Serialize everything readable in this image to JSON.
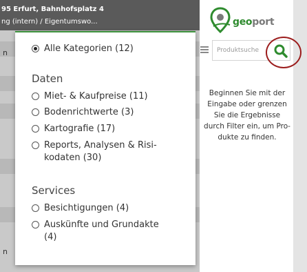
{
  "background": {
    "header_line1": "95 Erfurt, Bahnhofsplatz 4",
    "header_line2": "ng (intern) / Eigentumswo...",
    "left_text_1": "n",
    "left_text_2": "n"
  },
  "logo": {
    "text_geo": "geo",
    "text_port": "port",
    "accent_color": "#2e8b2e"
  },
  "search": {
    "placeholder": "Produktsuche",
    "button_icon": "search-icon"
  },
  "hint_text": "Beginnen Sie mit der Eingabe oder grenzen Sie die Er­gebnisse durch Fil­ter ein, um Pro­dukte zu finden.",
  "filter": {
    "all": {
      "label": "Alle Kategorien (12)",
      "selected": true
    },
    "sections": [
      {
        "title": "Daten",
        "items": [
          {
            "label": "Miet- & Kaufpreise (11)"
          },
          {
            "label": "Bodenrichtwerte (3)"
          },
          {
            "label": "Kartografie (17)"
          },
          {
            "label": "Reports, Analysen & Risi-kodaten (30)",
            "line1": "Reports, Analysen & Risi-",
            "line2": "kodaten (30)"
          }
        ]
      },
      {
        "title": "Services",
        "items": [
          {
            "label": "Besichtigungen (4)"
          },
          {
            "label": "Auskünfte und Grundakte (4)",
            "line1": "Auskünfte und Grundakte",
            "line2": "(4)"
          }
        ]
      }
    ]
  }
}
